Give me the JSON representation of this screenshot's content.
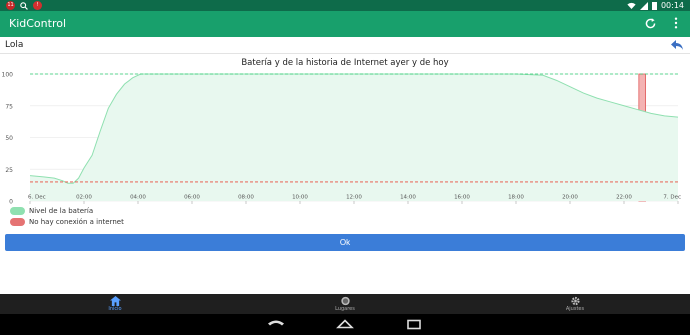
{
  "status_bar": {
    "left_icons": [
      "notification-badge-icon",
      "search-icon",
      "alert-badge-icon"
    ],
    "badge_text": "11",
    "time": "00:14",
    "right_icons": [
      "wifi-icon",
      "signal-icon",
      "battery-icon"
    ]
  },
  "app_bar": {
    "title": "KidControl",
    "actions": [
      "refresh-icon",
      "more-vert-icon"
    ]
  },
  "child": {
    "name": "Lola",
    "action_icon": "reply-icon"
  },
  "chart_data": {
    "type": "area",
    "title": "Batería y de la historia de Internet ayer y de hoy",
    "x_tick_labels": [
      "6. Dec",
      "02:00",
      "04:00",
      "06:00",
      "08:00",
      "10:00",
      "12:00",
      "14:00",
      "16:00",
      "18:00",
      "20:00",
      "22:00",
      "7. Dec"
    ],
    "x_tick_hours": [
      0,
      2,
      4,
      6,
      8,
      10,
      12,
      14,
      16,
      18,
      20,
      22,
      24
    ],
    "y_tick_labels": [
      "0",
      "25",
      "50",
      "75",
      "100"
    ],
    "ylim": [
      0,
      100
    ],
    "xlim_hours": [
      0,
      24
    ],
    "reference_lines": [
      {
        "value": 100,
        "color": "#2ecc71",
        "style": "dashed"
      },
      {
        "value": 15,
        "color": "#e74c3c",
        "style": "dashed"
      }
    ],
    "series": [
      {
        "name": "Nivel de la batería",
        "color": "#8fe0b0",
        "fill": "#e8f8ef",
        "points": [
          [
            0.0,
            20
          ],
          [
            0.5,
            19
          ],
          [
            0.9,
            18
          ],
          [
            1.2,
            16
          ],
          [
            1.4,
            14
          ],
          [
            1.6,
            14
          ],
          [
            1.8,
            18
          ],
          [
            2.0,
            26
          ],
          [
            2.3,
            36
          ],
          [
            2.6,
            55
          ],
          [
            2.9,
            73
          ],
          [
            3.2,
            84
          ],
          [
            3.5,
            92
          ],
          [
            3.8,
            97
          ],
          [
            4.1,
            100
          ],
          [
            6.0,
            100
          ],
          [
            10.0,
            100
          ],
          [
            14.0,
            100
          ],
          [
            18.0,
            100
          ],
          [
            19.0,
            99
          ],
          [
            19.5,
            95
          ],
          [
            20.0,
            90
          ],
          [
            20.5,
            85
          ],
          [
            21.0,
            81
          ],
          [
            21.5,
            78
          ],
          [
            22.0,
            75
          ],
          [
            22.5,
            72
          ],
          [
            23.0,
            69
          ],
          [
            23.5,
            67
          ],
          [
            24.0,
            66
          ]
        ]
      }
    ],
    "bands": [
      {
        "name": "No hay conexión a internet",
        "start_hour": 22.55,
        "end_hour": 22.8,
        "color": "#f4b3b3",
        "border": "#e05a5a"
      }
    ]
  },
  "legend": [
    {
      "label": "Nivel de la batería",
      "color": "#8fe0b0"
    },
    {
      "label": "No hay conexión a internet",
      "color": "#e57373"
    }
  ],
  "ok_button": {
    "label": "Ok"
  },
  "bottom_nav": [
    {
      "label": "Inicio",
      "icon": "home-icon",
      "active": true
    },
    {
      "label": "Lugares",
      "icon": "places-icon",
      "active": false
    },
    {
      "label": "Ajustes",
      "icon": "settings-icon",
      "active": false
    }
  ],
  "system_nav": [
    "back-icon",
    "home-icon",
    "recent-apps-icon"
  ]
}
